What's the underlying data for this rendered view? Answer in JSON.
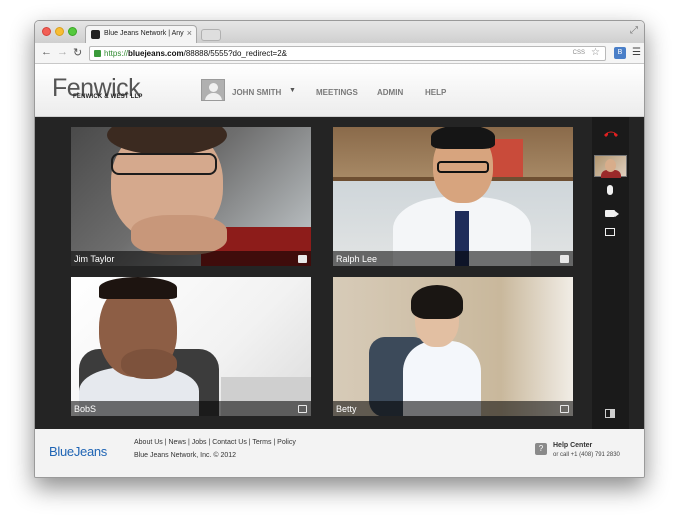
{
  "browser": {
    "tab_title": "Blue Jeans Network | Any",
    "tab_close": "×",
    "url_secure": "https://",
    "url_host": "bluejeans.com",
    "url_rest": "/88888/5555?do_redirect=2&",
    "omnibox_css": "CSS",
    "extension_label": "B",
    "icons": {
      "back": "back-arrow-icon",
      "forward": "forward-arrow-icon",
      "reload": "reload-icon",
      "star": "star-icon",
      "menu": "hamburger-menu-icon"
    }
  },
  "header": {
    "logo": "Fenwick",
    "logo_sub": "FENWICK & WEST LLP",
    "user_name": "JOHN SMITH",
    "nav": {
      "meetings": "MEETINGS",
      "admin": "ADMIN",
      "help": "HELP"
    }
  },
  "participants": [
    {
      "name": "Jim Taylor"
    },
    {
      "name": "Ralph Lee"
    },
    {
      "name": "BobS"
    },
    {
      "name": "Betty"
    }
  ],
  "sidebar": {
    "colors": {
      "hangup": "#e02020"
    }
  },
  "footer": {
    "brand": "BlueJeans",
    "links": "About Us | News | Jobs | Contact Us | Terms | Policy",
    "copyright": "Blue Jeans Network, Inc. © 2012",
    "help_title": "Help Center",
    "help_phone": "or call +1 (408) 791 2830",
    "help_icon_glyph": "?"
  }
}
